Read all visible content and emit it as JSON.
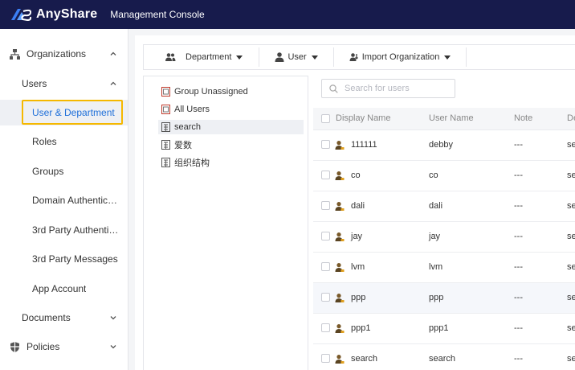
{
  "topbar": {
    "brand": "AnyShare",
    "console": "Management Console"
  },
  "sidebar": {
    "organizations": "Organizations",
    "users": "Users",
    "user_department": "User & Department",
    "roles": "Roles",
    "groups": "Groups",
    "domain_auth": "Domain Authentic…",
    "third_party_auth": "3rd Party Authenti…",
    "third_party_msg": "3rd Party Messages",
    "app_account": "App Account",
    "documents": "Documents",
    "policies": "Policies"
  },
  "toolbar": {
    "department": "Department",
    "user": "User",
    "import": "Import Organization"
  },
  "tree": {
    "items": [
      "Group Unassigned",
      "All Users",
      "search",
      "爱数",
      "组织结构"
    ]
  },
  "search": {
    "placeholder": "Search for users"
  },
  "table": {
    "headers": [
      "Display Name",
      "User Name",
      "Note",
      "De"
    ],
    "rows": [
      {
        "display": "111111",
        "user": "debby",
        "note": "---",
        "extra": "se"
      },
      {
        "display": "co",
        "user": "co",
        "note": "---",
        "extra": "se"
      },
      {
        "display": "dali",
        "user": "dali",
        "note": "---",
        "extra": "se"
      },
      {
        "display": "jay",
        "user": "jay",
        "note": "---",
        "extra": "se"
      },
      {
        "display": "lvm",
        "user": "lvm",
        "note": "---",
        "extra": "se"
      },
      {
        "display": "ppp",
        "user": "ppp",
        "note": "---",
        "extra": "se"
      },
      {
        "display": "ppp1",
        "user": "ppp1",
        "note": "---",
        "extra": "se"
      },
      {
        "display": "search",
        "user": "search",
        "note": "---",
        "extra": "se"
      }
    ]
  },
  "colors": {
    "topbar": "#171b4c",
    "accent": "#1e6fd9",
    "highlight_border": "#f5b800"
  }
}
